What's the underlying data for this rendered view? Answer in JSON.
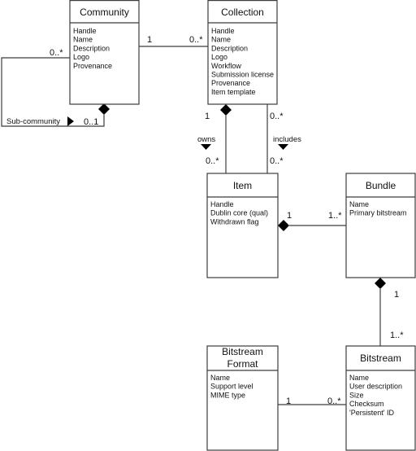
{
  "classes": {
    "community": {
      "title": "Community",
      "attributes": [
        "Handle",
        "Name",
        "Description",
        "Logo",
        "Provenance"
      ]
    },
    "collection": {
      "title": "Collection",
      "attributes": [
        "Handle",
        "Name",
        "Description",
        "Logo",
        "Workflow",
        "Submission license",
        "Provenance",
        "Item template"
      ]
    },
    "item": {
      "title": "Item",
      "attributes": [
        "Handle",
        "Dublin core (qual)",
        "Withdrawn flag"
      ]
    },
    "bundle": {
      "title": "Bundle",
      "attributes": [
        "Name",
        "Primary bitstream"
      ]
    },
    "bitstream_format": {
      "title_line1": "Bitstream",
      "title_line2": "Format",
      "attributes": [
        "Name",
        "Support level",
        "MIME type"
      ]
    },
    "bitstream": {
      "title": "Bitstream",
      "attributes": [
        "Name",
        "User description",
        "Size",
        "Checksum",
        "'Persistent' ID"
      ]
    }
  },
  "associations": {
    "community_collection": {
      "from_mult": "1",
      "to_mult": "0..*"
    },
    "sub_community": {
      "name": "Sub-community",
      "from_mult": "0..*",
      "to_mult": "0..1"
    },
    "owns": {
      "name": "owns",
      "from_mult": "1",
      "to_mult": "0..*"
    },
    "includes": {
      "name": "includes",
      "from_mult": "0..*",
      "to_mult": "0..*"
    },
    "item_bundle": {
      "from_mult": "1",
      "to_mult": "1..*"
    },
    "bundle_bitstream": {
      "from_mult": "1",
      "to_mult": "1..*"
    },
    "format_bitstream": {
      "from_mult": "1",
      "to_mult": "0..*"
    }
  }
}
